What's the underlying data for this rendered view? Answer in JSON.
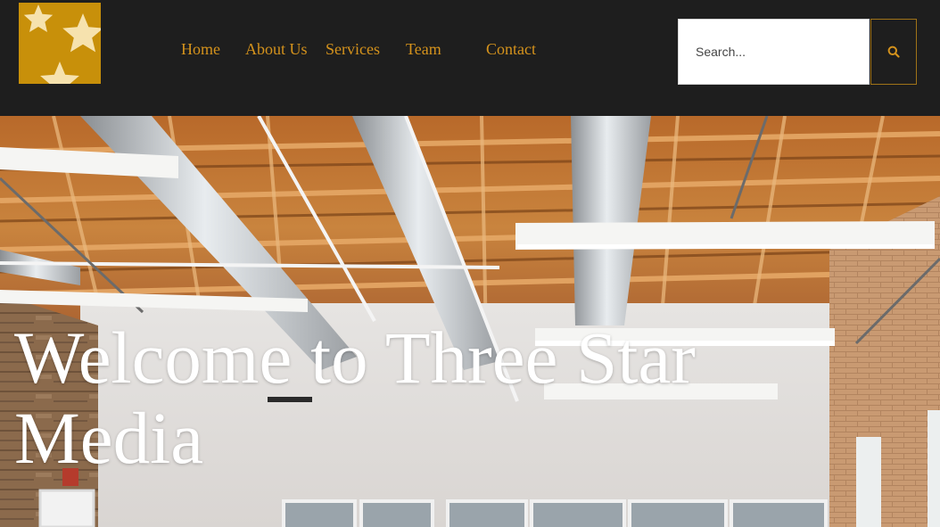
{
  "header": {
    "logo_icon": "three-stars-logo",
    "brand_color": "#c8900a",
    "nav": [
      {
        "label": "Home"
      },
      {
        "label": "About Us"
      },
      {
        "label": "Services"
      },
      {
        "label": "Team"
      },
      {
        "label": "Contact"
      }
    ],
    "nav_color": "#d4921c",
    "search": {
      "placeholder": "Search...",
      "value": "",
      "button_icon": "search-icon"
    }
  },
  "hero": {
    "title": "Welcome to Three Star Media",
    "background": "office-interior-exposed-wood-ceiling-photo"
  }
}
